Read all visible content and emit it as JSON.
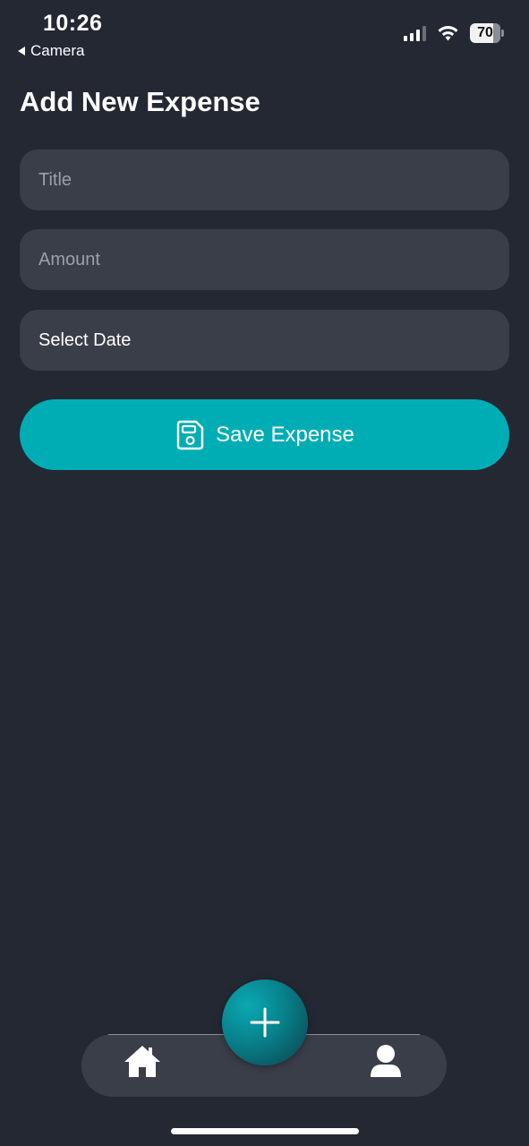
{
  "status_bar": {
    "time": "10:26",
    "back_label": "Camera",
    "battery": "70"
  },
  "page": {
    "title": "Add New Expense"
  },
  "form": {
    "title_placeholder": "Title",
    "amount_placeholder": "Amount",
    "date_label": "Select Date",
    "save_label": "Save Expense"
  },
  "icons": {
    "save": "floppy-disk-icon",
    "home": "home-icon",
    "add": "plus-icon",
    "profile": "user-icon"
  },
  "colors": {
    "background": "#232833",
    "field": "#3a3e49",
    "accent": "#00adb5"
  }
}
